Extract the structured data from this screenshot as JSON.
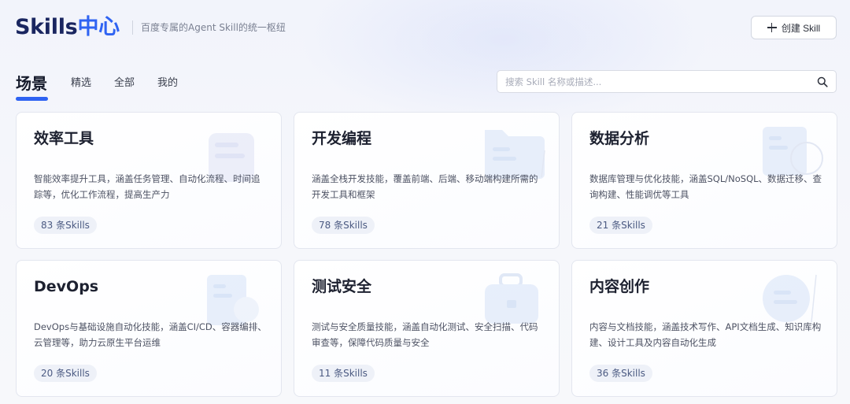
{
  "header": {
    "logo_main": "Skills",
    "logo_accent": "中心",
    "subtitle": "百度专属的Agent Skill的统一枢纽",
    "create_button_label": "创建 Skill"
  },
  "tabs": [
    {
      "label": "场景",
      "active": true
    },
    {
      "label": "精选",
      "active": false
    },
    {
      "label": "全部",
      "active": false
    },
    {
      "label": "我的",
      "active": false
    }
  ],
  "search": {
    "placeholder": "搜索 Skill 名称或描述...",
    "value": ""
  },
  "cards": [
    {
      "title": "效率工具",
      "description": "智能效率提升工具，涵盖任务管理、自动化流程、时间追踪等，优化工作流程，提高生产力",
      "count_label": "83 条Skills",
      "icon": "document-stack-icon"
    },
    {
      "title": "开发编程",
      "description": "涵盖全栈开发技能，覆盖前端、后端、移动端构建所需的开发工具和框架",
      "count_label": "78 条Skills",
      "icon": "folder-icon"
    },
    {
      "title": "数据分析",
      "description": "数据库管理与优化技能，涵盖SQL/NoSQL、数据迁移、查询构建、性能调优等工具",
      "count_label": "21 条Skills",
      "icon": "chart-card-icon"
    },
    {
      "title": "DevOps",
      "description": "DevOps与基础设施自动化技能，涵盖CI/CD、容器编排、云管理等，助力云原生平台运维",
      "count_label": "20 条Skills",
      "icon": "server-stack-icon"
    },
    {
      "title": "测试安全",
      "description": "测试与安全质量技能，涵盖自动化测试、安全扫描、代码审查等，保障代码质量与安全",
      "count_label": "11 条Skills",
      "icon": "briefcase-icon"
    },
    {
      "title": "内容创作",
      "description": "内容与文档技能，涵盖技术写作、API文档生成、知识库构建、设计工具及内容自动化生成",
      "count_label": "36 条Skills",
      "icon": "pen-card-icon"
    }
  ],
  "colors": {
    "brand_dark": "#1a2660",
    "brand_blue": "#2f63f2",
    "badge_bg": "#eef1f8",
    "badge_text": "#4b5a82"
  }
}
